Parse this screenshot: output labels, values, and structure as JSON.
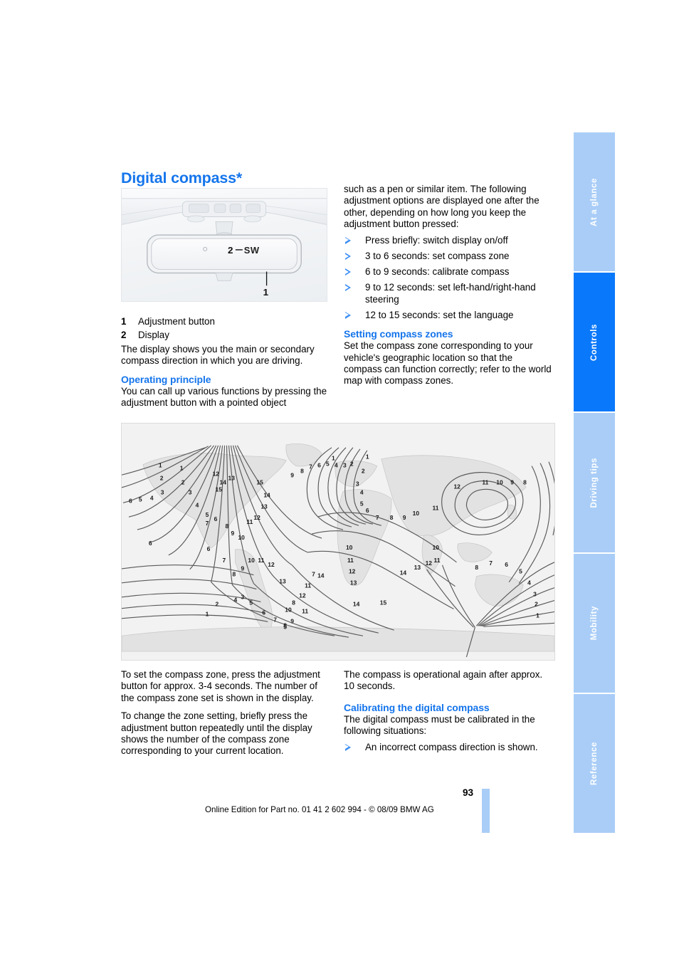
{
  "page": {
    "title": "Digital compass*",
    "number": "93",
    "footer": "Online Edition for Part no. 01 41 2 602 994 - © 08/09 BMW AG",
    "accent_color": "#1575ec",
    "tab_active_color": "#0a78fa",
    "tab_inactive_color": "#a9cdf7"
  },
  "tabs": [
    {
      "label": "At a glance",
      "active": false
    },
    {
      "label": "Controls",
      "active": true
    },
    {
      "label": "Driving tips",
      "active": false
    },
    {
      "label": "Mobility",
      "active": false
    },
    {
      "label": "Reference",
      "active": false
    }
  ],
  "figure_mirror": {
    "name": "rear-view-mirror-with-digital-compass",
    "callout_1": "1",
    "callout_2": "2",
    "display_text": "SW",
    "watermark": ""
  },
  "legend": [
    {
      "num": "1",
      "text": "Adjustment button"
    },
    {
      "num": "2",
      "text": "Display"
    }
  ],
  "left_column": {
    "intro": "The display shows you the main or secondary compass direction in which you are driving.",
    "operating_principle_heading": "Operating principle",
    "operating_principle_text": "You can call up various functions by pressing the adjustment button with a pointed object"
  },
  "right_column": {
    "continuation": "such as a pen or similar item. The following adjustment options are displayed one after the other, depending on how long you keep the adjustment button pressed:",
    "options": [
      "Press briefly: switch display on/off",
      "3 to 6 seconds: set compass zone",
      "6 to 9 seconds: calibrate compass",
      "9 to 12 seconds: set left-hand/right-hand steering",
      "12 to 15 seconds: set the language"
    ],
    "setting_zones_heading": "Setting compass zones",
    "setting_zones_text": "Set the compass zone corresponding to your vehicle's geographic location so that the compass can function correctly; refer to the world map with compass zones."
  },
  "figure_map": {
    "name": "world-map-with-compass-zones",
    "watermark": "",
    "zone_labels": [
      "1",
      "2",
      "3",
      "4",
      "5",
      "6",
      "7",
      "8",
      "9",
      "10",
      "11",
      "12",
      "13",
      "14",
      "15"
    ]
  },
  "bottom_left": {
    "para1": "To set the compass zone, press the adjustment button for approx. 3-4 seconds. The number of the compass zone set is shown in the display.",
    "para2": "To change the zone setting, briefly press the adjustment button repeatedly until the display shows the number of the compass zone corresponding to your current location."
  },
  "bottom_right": {
    "para1": "The compass is operational again after approx. 10 seconds.",
    "calibrating_heading": "Calibrating the digital compass",
    "calibrating_text": "The digital compass must be calibrated in the following situations:",
    "calibrating_items": [
      "An incorrect compass direction is shown."
    ]
  }
}
